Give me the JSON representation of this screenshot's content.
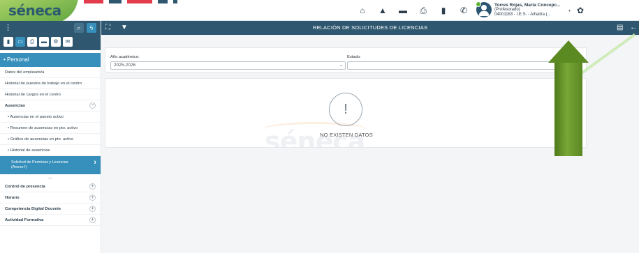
{
  "app": {
    "logo_text": "séneca"
  },
  "topbar": {
    "icons": [
      "home-icon",
      "graduation-cap-icon",
      "folder-icon",
      "printer-icon",
      "clipboard-icon",
      "phone-icon"
    ],
    "user": {
      "name": "Torres Rojas, María Concepc...",
      "role": "(Profesorado)",
      "center": "04001163 - I.E.S. - Alhadra (..."
    }
  },
  "sidebar": {
    "section": "• Personal",
    "items": [
      {
        "label": "Datos del empleado/a"
      },
      {
        "label": "Historial de puestos de trabajo en el centro"
      },
      {
        "label": "Historial de cargos en el centro"
      }
    ],
    "group": {
      "label": "Ausencias",
      "subitems": [
        {
          "label": "• Ausencias en el puesto activo"
        },
        {
          "label": "• Resumen de ausencias en pto. activo"
        },
        {
          "label": "• Gráfico de ausencias en pto. activo"
        },
        {
          "label": "• Historial de ausencias"
        }
      ],
      "active": {
        "line1": "Solicitud de Permisos y Licencias",
        "line2": "(Anexo I)"
      }
    },
    "collapsed_groups": [
      {
        "label": "Control de presencia"
      },
      {
        "label": "Horario"
      },
      {
        "label": "Competencia Digital Docente"
      },
      {
        "label": "Actividad Formativa"
      }
    ]
  },
  "main": {
    "title": "RELACIÓN DE SOLICITUDES DE LICENCIAS",
    "filters": {
      "year_label": "Año académico:",
      "year_value": "2025-2026",
      "status_label": "Estado:",
      "status_value": ""
    },
    "empty": {
      "icon": "!",
      "message": "NO EXISTEN DATOS"
    },
    "watermark": "séneca"
  },
  "colors": {
    "header": "#2f5870",
    "accent": "#3790bc",
    "arrow": "#5c8a22"
  }
}
